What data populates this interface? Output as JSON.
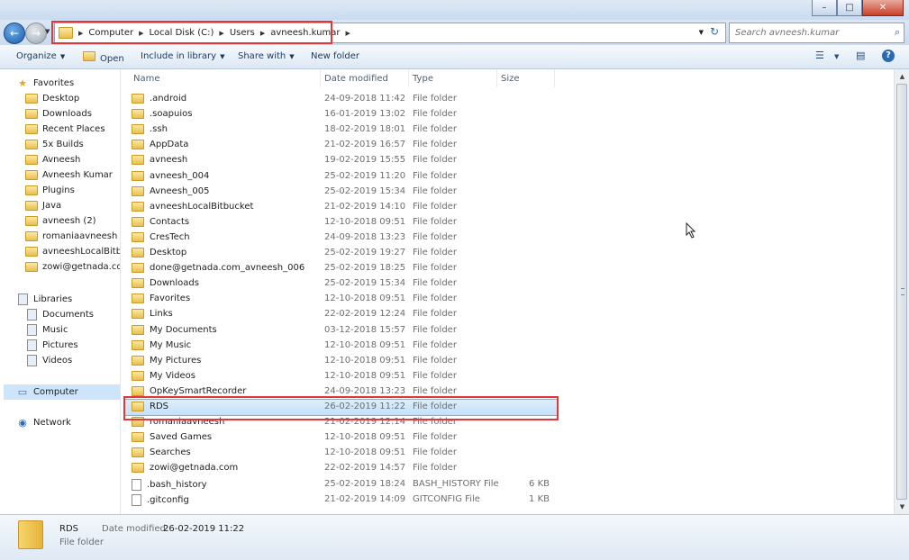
{
  "window": {
    "minimize": "–",
    "maximize": "□",
    "close": "✕"
  },
  "address_bar": {
    "crumbs": [
      "Computer",
      "Local Disk (C:)",
      "Users",
      "avneesh.kumar"
    ],
    "search_placeholder": "Search avneesh.kumar"
  },
  "toolbar": {
    "organize": "Organize",
    "open": "Open",
    "include_in_library": "Include in library",
    "share_with": "Share with",
    "new_folder": "New folder"
  },
  "nav": {
    "favorites_label": "Favorites",
    "favorites": [
      "Desktop",
      "Downloads",
      "Recent Places",
      "5x Builds",
      "Avneesh",
      "Avneesh Kumar",
      "Plugins",
      "Java",
      "avneesh (2)",
      "romaniaavneesh",
      "avneeshLocalBitbuc",
      "zowi@getnada.com"
    ],
    "libraries_label": "Libraries",
    "libraries": [
      "Documents",
      "Music",
      "Pictures",
      "Videos"
    ],
    "computer_label": "Computer",
    "network_label": "Network"
  },
  "columns": {
    "name": "Name",
    "date_modified": "Date modified",
    "type": "Type",
    "size": "Size"
  },
  "files": [
    {
      "name": ".android",
      "date": "24-09-2018 11:42",
      "type": "File folder",
      "size": ""
    },
    {
      "name": ".soapuios",
      "date": "16-01-2019 13:02",
      "type": "File folder",
      "size": ""
    },
    {
      "name": ".ssh",
      "date": "18-02-2019 18:01",
      "type": "File folder",
      "size": ""
    },
    {
      "name": "AppData",
      "date": "21-02-2019 16:57",
      "type": "File folder",
      "size": ""
    },
    {
      "name": "avneesh",
      "date": "19-02-2019 15:55",
      "type": "File folder",
      "size": ""
    },
    {
      "name": "avneesh_004",
      "date": "25-02-2019 11:20",
      "type": "File folder",
      "size": ""
    },
    {
      "name": "Avneesh_005",
      "date": "25-02-2019 15:34",
      "type": "File folder",
      "size": ""
    },
    {
      "name": "avneeshLocalBitbucket",
      "date": "21-02-2019 14:10",
      "type": "File folder",
      "size": ""
    },
    {
      "name": "Contacts",
      "date": "12-10-2018 09:51",
      "type": "File folder",
      "size": ""
    },
    {
      "name": "CresTech",
      "date": "24-09-2018 13:23",
      "type": "File folder",
      "size": ""
    },
    {
      "name": "Desktop",
      "date": "25-02-2019 19:27",
      "type": "File folder",
      "size": ""
    },
    {
      "name": "done@getnada.com_avneesh_006",
      "date": "25-02-2019 18:25",
      "type": "File folder",
      "size": ""
    },
    {
      "name": "Downloads",
      "date": "25-02-2019 15:34",
      "type": "File folder",
      "size": ""
    },
    {
      "name": "Favorites",
      "date": "12-10-2018 09:51",
      "type": "File folder",
      "size": ""
    },
    {
      "name": "Links",
      "date": "22-02-2019 12:24",
      "type": "File folder",
      "size": ""
    },
    {
      "name": "My Documents",
      "date": "03-12-2018 15:57",
      "type": "File folder",
      "size": ""
    },
    {
      "name": "My Music",
      "date": "12-10-2018 09:51",
      "type": "File folder",
      "size": ""
    },
    {
      "name": "My Pictures",
      "date": "12-10-2018 09:51",
      "type": "File folder",
      "size": ""
    },
    {
      "name": "My Videos",
      "date": "12-10-2018 09:51",
      "type": "File folder",
      "size": ""
    },
    {
      "name": "OpKeySmartRecorder",
      "date": "24-09-2018 13:23",
      "type": "File folder",
      "size": ""
    },
    {
      "name": "RDS",
      "date": "26-02-2019 11:22",
      "type": "File folder",
      "size": "",
      "selected": true
    },
    {
      "name": "romaniaavneesh",
      "date": "21-02-2019 12:14",
      "type": "File folder",
      "size": ""
    },
    {
      "name": "Saved Games",
      "date": "12-10-2018 09:51",
      "type": "File folder",
      "size": ""
    },
    {
      "name": "Searches",
      "date": "12-10-2018 09:51",
      "type": "File folder",
      "size": ""
    },
    {
      "name": "zowi@getnada.com",
      "date": "22-02-2019 14:57",
      "type": "File folder",
      "size": ""
    },
    {
      "name": ".bash_history",
      "date": "25-02-2019 18:24",
      "type": "BASH_HISTORY File",
      "size": "6 KB"
    },
    {
      "name": ".gitconfig",
      "date": "21-02-2019 14:09",
      "type": "GITCONFIG File",
      "size": "1 KB"
    }
  ],
  "details": {
    "name": "RDS",
    "modified_label": "Date modified:",
    "modified_value": "26-02-2019 11:22",
    "type": "File folder"
  },
  "colors": {
    "highlight": "#e0373d",
    "selection": "#cde4fa"
  },
  "icons": {
    "back": "←",
    "forward": "→",
    "refresh": "↻",
    "search": "⌕",
    "favorites": "★",
    "views": "☰",
    "preview": "▤",
    "help": "?"
  }
}
